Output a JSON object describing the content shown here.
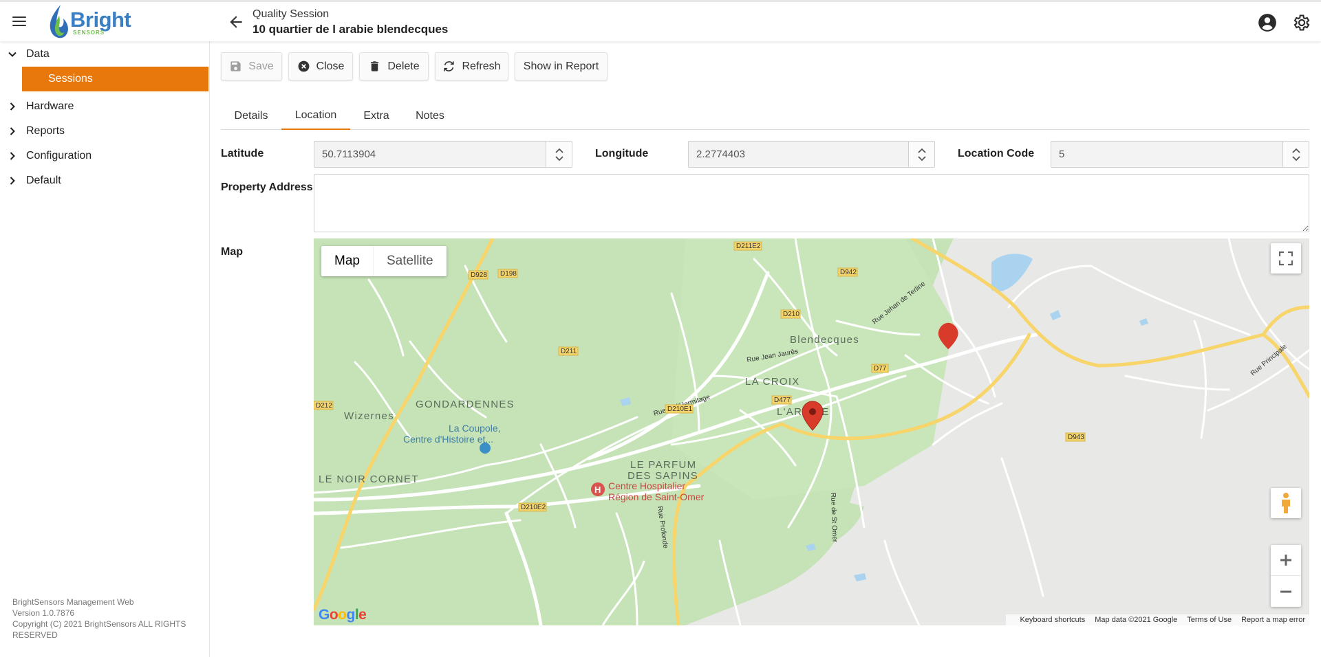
{
  "header": {
    "brand": "Bright",
    "brand_sub": "SENSORS",
    "session_kind": "Quality Session",
    "session_title": "10 quartier de l arabie blendecques"
  },
  "sidebar": {
    "items": [
      {
        "label": "Data",
        "expanded": true
      },
      {
        "label": "Sessions"
      },
      {
        "label": "Hardware",
        "expanded": false
      },
      {
        "label": "Reports",
        "expanded": false
      },
      {
        "label": "Configuration",
        "expanded": false
      },
      {
        "label": "Default",
        "expanded": false
      }
    ],
    "footer": {
      "app_name": "BrightSensors Management Web",
      "version": "Version 1.0.7876",
      "copyright": "Copyright (C) 2021 BrightSensors ALL RIGHTS RESERVED"
    }
  },
  "toolbar": {
    "save": "Save",
    "close": "Close",
    "delete": "Delete",
    "refresh": "Refresh",
    "show_in_report": "Show in Report"
  },
  "tabs": [
    "Details",
    "Location",
    "Extra",
    "Notes"
  ],
  "active_tab": "Location",
  "form": {
    "latitude_label": "Latitude",
    "latitude_value": "50.7113904",
    "longitude_label": "Longitude",
    "longitude_value": "2.2774403",
    "location_code_label": "Location Code",
    "location_code_value": "5",
    "property_address_label": "Property Address",
    "property_address_value": "",
    "map_label": "Map"
  },
  "map": {
    "type_map": "Map",
    "type_satellite": "Satellite",
    "places": [
      "Blendecques",
      "LA CROIX",
      "L'ARABIE",
      "GONDARDENNES",
      "Wizernes",
      "LE PARFUM",
      "DES SAPINS",
      "LE NOIR CORNET"
    ],
    "poi": {
      "museum_line1": "La Coupole,",
      "museum_line2": "Centre d'Histoire et...",
      "hospital_line1": "Centre Hospitalier",
      "hospital_line2": "Région de Saint-Omer"
    },
    "streets": [
      "Rue Jean Jaurès",
      "Rue de l'Hermitage",
      "Rue Jehan de Terline",
      "Rue Principale",
      "Rue Profonde",
      "Rue de St Omer"
    ],
    "roads": [
      "D928",
      "D198",
      "D211",
      "D211E2",
      "D942",
      "D210",
      "D77",
      "D477",
      "D210E1",
      "D212",
      "D210E2",
      "D943"
    ],
    "attribution": {
      "shortcuts": "Keyboard shortcuts",
      "data": "Map data ©2021 Google",
      "terms": "Terms of Use",
      "report": "Report a map error"
    },
    "google": "Google",
    "colors": {
      "forest": "#c5e3b7",
      "land": "#e8e8e6",
      "water": "#aad3f0",
      "highway": "#f7d56b",
      "marker": "#d93b2b"
    }
  },
  "colors": {
    "accent": "#e8780c",
    "brand_blue": "#3a7fc4",
    "brand_green": "#6cbf4a"
  }
}
